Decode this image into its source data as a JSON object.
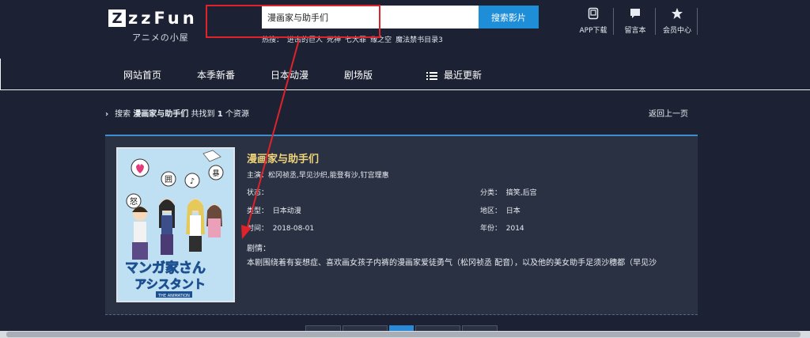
{
  "logo": {
    "letters": "zzFun",
    "box_letter": "Z",
    "subtitle": "アニメの小屋"
  },
  "search": {
    "value": "漫画家与助手们",
    "button": "搜索影片"
  },
  "hot": {
    "label": "热搜：",
    "items": [
      "进击的巨人",
      "死神",
      "七大罪",
      "缘之空",
      "魔法禁书目录3"
    ]
  },
  "toplinks": [
    {
      "label": "APP下载",
      "icon": "tablet-icon"
    },
    {
      "label": "留言本",
      "icon": "chat-icon"
    },
    {
      "label": "会员中心",
      "icon": "star-icon"
    }
  ],
  "nav": {
    "home": "网站首页",
    "season": "本季新番",
    "anime": "日本动漫",
    "theater": "剧场版",
    "latest": "最近更新"
  },
  "crumb": {
    "prefix": "搜索",
    "keyword": "漫画家与助手们",
    "found": "共找到",
    "count": "1",
    "suffix": "个资源",
    "back": "返回上一页"
  },
  "result": {
    "title": "漫画家与助手们",
    "cast_label": "主演：",
    "cast": "松冈祯丞,早见沙织,能登有沙,钉宫理惠",
    "status_label": "状态：",
    "status": "",
    "genre_label": "分类：",
    "genre": "搞笑,后宫",
    "type_label": "类型：",
    "type": "日本动漫",
    "region_label": "地区：",
    "region": "日本",
    "date_label": "时间：",
    "date": "2018-08-01",
    "year_label": "年份：",
    "year": "2014",
    "plot_label": "剧情：",
    "plot": "本剧围绕着有妄想症、喜欢画女孩子内裤的漫画家爱徒勇气（松冈祯丞 配音），以及他的美女助手足须沙穗都（早见沙",
    "poster_title": "マンガ家さん",
    "poster_title2": "アシスタント",
    "poster_tag": "THE ANIMATION",
    "poster_glyphs": [
      "囲",
      "♪",
      "暴",
      "怒"
    ]
  },
  "colors": {
    "bg": "#1c2233",
    "card": "#2a3142",
    "accent": "#1f8ed9",
    "title": "#f0d57a",
    "annotation": "#e0232a"
  }
}
